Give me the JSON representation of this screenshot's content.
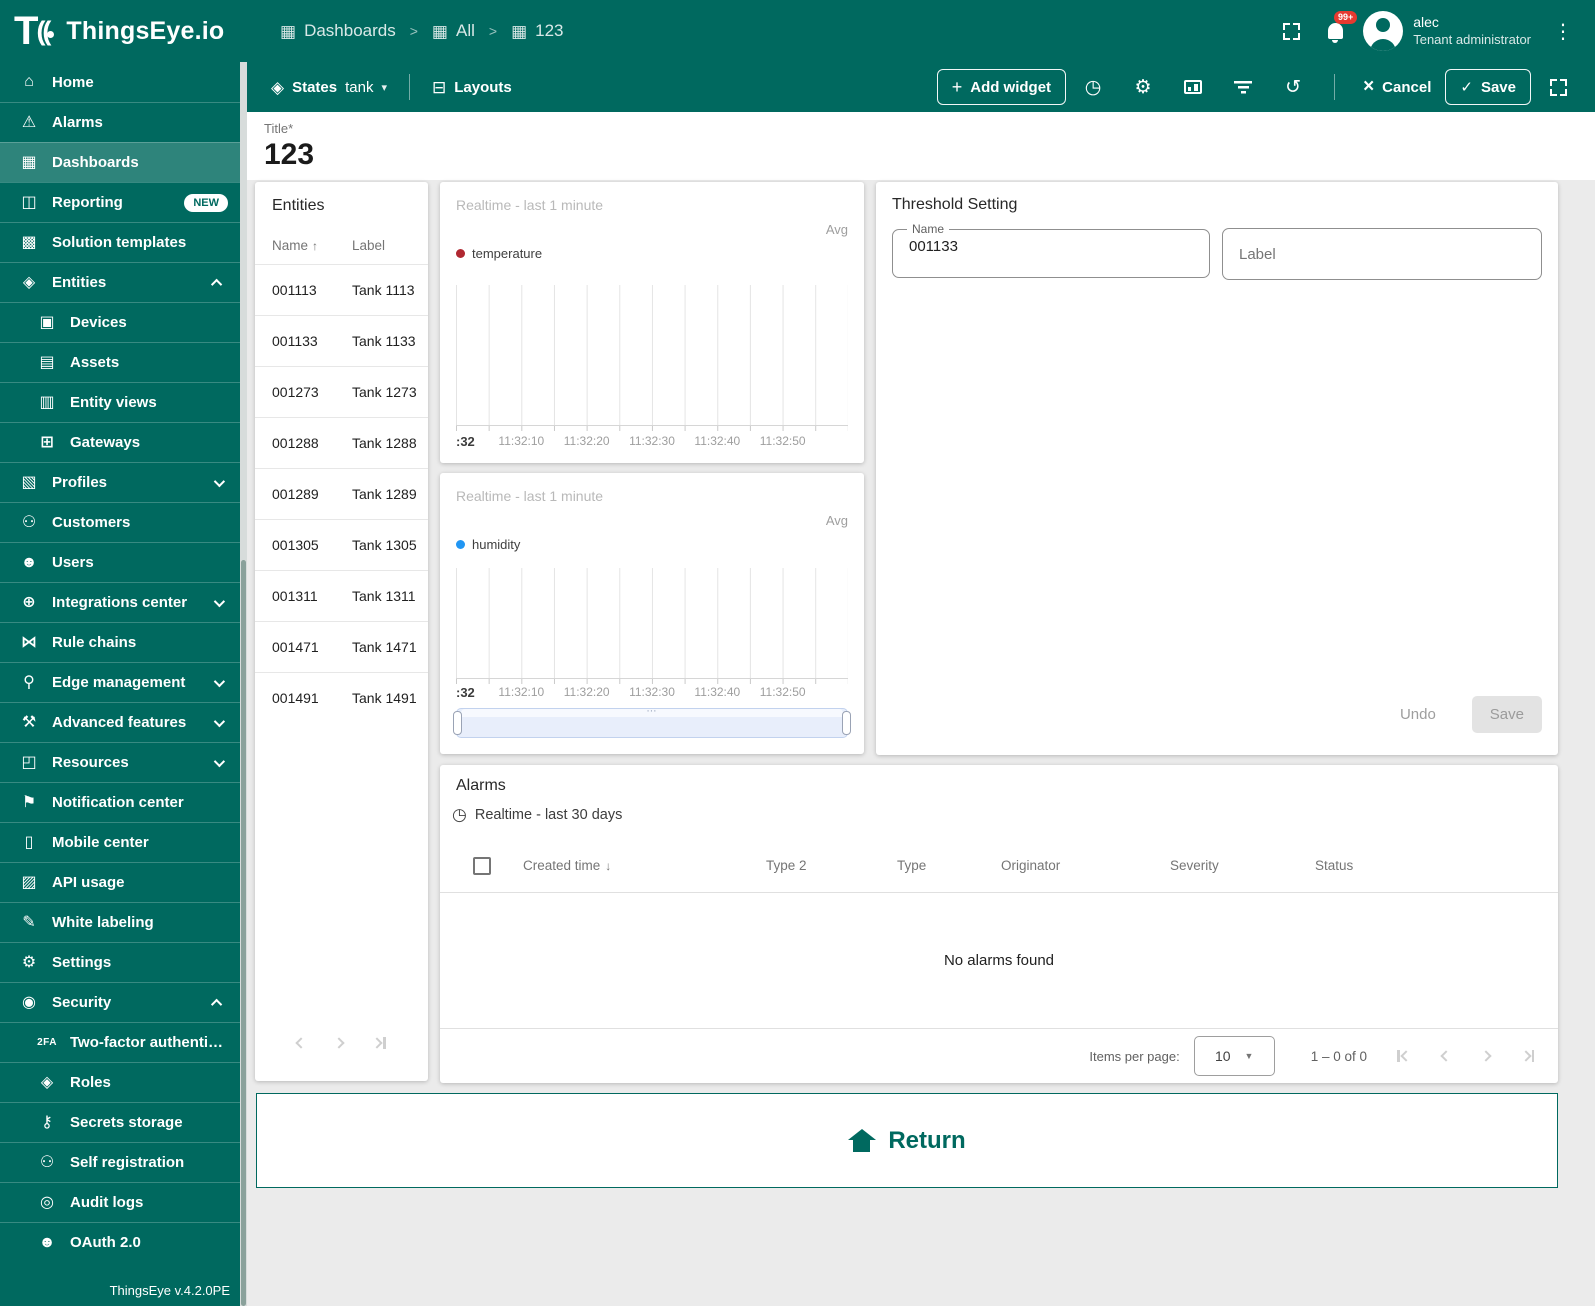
{
  "header": {
    "brand": "ThingsEye.io",
    "separator": ">",
    "breadcrumbs": [
      "Dashboards",
      "All",
      "123"
    ],
    "notification_badge": "99+",
    "user_name": "alec",
    "user_role": "Tenant administrator"
  },
  "toolbar": {
    "states_label": "States",
    "states_value": "tank",
    "layouts_label": "Layouts",
    "add_widget_label": "Add widget",
    "cancel_label": "Cancel",
    "save_label": "Save"
  },
  "title_field": {
    "label": "Title*",
    "value": "123"
  },
  "sidebar": {
    "footer": "ThingsEye v.4.2.0PE",
    "items": [
      {
        "label": "Home"
      },
      {
        "label": "Alarms"
      },
      {
        "label": "Dashboards"
      },
      {
        "label": "Reporting",
        "badge": "NEW"
      },
      {
        "label": "Solution templates"
      },
      {
        "label": "Entities"
      },
      {
        "label": "Devices"
      },
      {
        "label": "Assets"
      },
      {
        "label": "Entity views"
      },
      {
        "label": "Gateways"
      },
      {
        "label": "Profiles"
      },
      {
        "label": "Customers"
      },
      {
        "label": "Users"
      },
      {
        "label": "Integrations center"
      },
      {
        "label": "Rule chains"
      },
      {
        "label": "Edge management"
      },
      {
        "label": "Advanced features"
      },
      {
        "label": "Resources"
      },
      {
        "label": "Notification center"
      },
      {
        "label": "Mobile center"
      },
      {
        "label": "API usage"
      },
      {
        "label": "White labeling"
      },
      {
        "label": "Settings"
      },
      {
        "label": "Security"
      },
      {
        "label": "Two-factor authenticati…"
      },
      {
        "label": "Roles"
      },
      {
        "label": "Secrets storage"
      },
      {
        "label": "Self registration"
      },
      {
        "label": "Audit logs"
      },
      {
        "label": "OAuth 2.0"
      }
    ]
  },
  "entities_widget": {
    "title": "Entities",
    "columns": [
      "Name",
      "Label"
    ],
    "rows": [
      [
        "001113",
        "Tank 1113"
      ],
      [
        "001133",
        "Tank 1133"
      ],
      [
        "001273",
        "Tank 1273"
      ],
      [
        "001288",
        "Tank 1288"
      ],
      [
        "001289",
        "Tank 1289"
      ],
      [
        "001305",
        "Tank 1305"
      ],
      [
        "001311",
        "Tank 1311"
      ],
      [
        "001471",
        "Tank 1471"
      ],
      [
        "001491",
        "Tank 1491"
      ]
    ]
  },
  "charts": [
    {
      "timewindow": "Realtime - last 1 minute",
      "aggregation": "Avg",
      "series": "temperature",
      "series_color": "#b02831",
      "x_labels": [
        ":32",
        "11:32:10",
        "11:32:20",
        "11:32:30",
        "11:32:40",
        "11:32:50"
      ],
      "values": []
    },
    {
      "timewindow": "Realtime - last 1 minute",
      "aggregation": "Avg",
      "series": "humidity",
      "series_color": "#2196f3",
      "x_labels": [
        ":32",
        "11:32:10",
        "11:32:20",
        "11:32:30",
        "11:32:40",
        "11:32:50"
      ],
      "values": []
    }
  ],
  "threshold_widget": {
    "title": "Threshold Setting",
    "name_label": "Name",
    "name_value": "001133",
    "label_placeholder": "Label",
    "undo_label": "Undo",
    "save_label": "Save"
  },
  "alarms_widget": {
    "title": "Alarms",
    "timewindow": "Realtime - last 30 days",
    "columns": [
      "Created time",
      "Type 2",
      "Type",
      "Originator",
      "Severity",
      "Status"
    ],
    "empty_text": "No alarms found",
    "items_per_page_label": "Items per page:",
    "items_per_page_value": "10",
    "range_text": "1 – 0 of 0"
  },
  "return_button": {
    "label": "Return"
  },
  "icons": {
    "home": "⌂",
    "alarms": "⚠",
    "dashboards": "▦",
    "reporting": "◫",
    "solution_templates": "▩",
    "entities": "◈",
    "devices": "▣",
    "assets": "▤",
    "entity_views": "▥",
    "gateways": "⊞",
    "profiles": "▧",
    "customers": "⚇",
    "users": "☻",
    "integrations": "⊕",
    "rule_chains": "⋈",
    "edge": "⚲",
    "advanced": "⚒",
    "resources": "◰",
    "notification": "⚑",
    "mobile": "▯",
    "api": "▨",
    "white_labeling": "✎",
    "settings": "⚙",
    "security": "◉",
    "two_factor": "2FA",
    "roles": "◈",
    "secrets": "⚷",
    "self_registration": "⚇",
    "audit": "◎",
    "oauth": "☻",
    "states": "◈",
    "layouts": "⊟",
    "clock": "◷",
    "gear": "⚙",
    "history": "↺",
    "plus": "+",
    "check": "✓",
    "close": "×",
    "caret_down": "▾",
    "kebab": "⋮",
    "sort_asc": "↑",
    "sort_desc": "↓",
    "select_arrow": "▼",
    "grip": "⋯"
  },
  "colors": {
    "primary": "#00695f",
    "badge_red": "#e63a30",
    "temperature_series": "#b02831",
    "humidity_series": "#2196f3",
    "canvas_bg": "#ebebeb"
  }
}
